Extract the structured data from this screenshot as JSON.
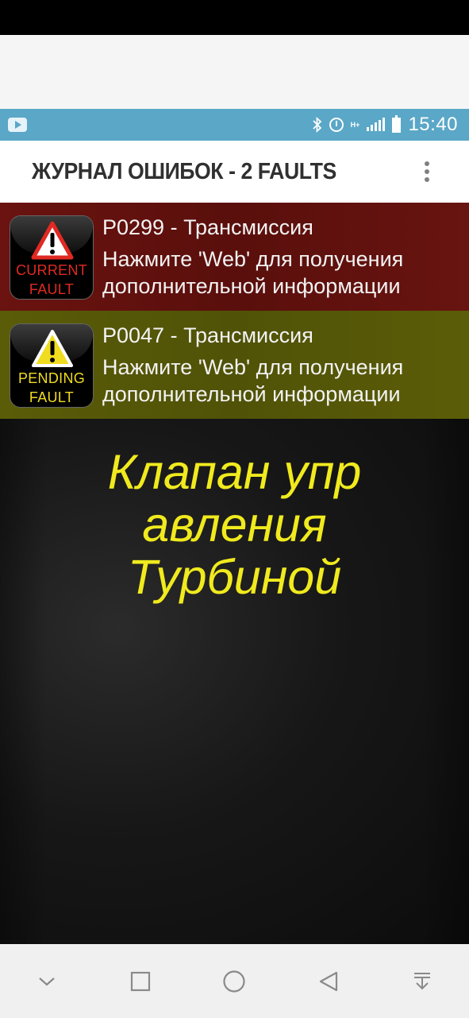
{
  "status_bar": {
    "time": "15:40",
    "network_label": "H+",
    "icons": [
      "youtube-icon",
      "bluetooth-icon",
      "alarm-icon",
      "network-type-icon",
      "signal-icon",
      "battery-icon"
    ]
  },
  "app_bar": {
    "title": "ЖУРНАЛ ОШИБОК - 2 FAULTS",
    "menu_icon": "more-vert-icon"
  },
  "faults": [
    {
      "code_line": "P0299 - Трансмиссия",
      "desc_line1": "Нажмите 'Web' для получения",
      "desc_line2": "дополнительной информации",
      "badge_line1": "CURRENT",
      "badge_line2": "FAULT",
      "badge_color": "#e02a22",
      "row_color": "#5e0f0c"
    },
    {
      "code_line": "P0047 - Трансмиссия",
      "desc_line1": "Нажмите 'Web' для получения",
      "desc_line2": "дополнительной информации",
      "badge_line1": "PENDING",
      "badge_line2": "FAULT",
      "badge_color": "#f0dc20",
      "row_color": "#505207"
    }
  ],
  "main": {
    "hero_text": "Клапан упр\nавления\nТурбиной",
    "hero_color": "#f0ea1e"
  },
  "nav_bar": {
    "icons": [
      "chevron-down-icon",
      "recents-square-icon",
      "home-circle-icon",
      "back-triangle-icon",
      "pin-down-icon"
    ]
  }
}
